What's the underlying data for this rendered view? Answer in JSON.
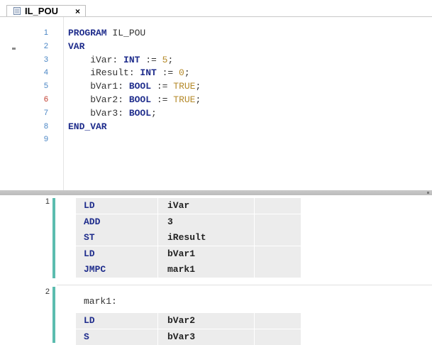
{
  "tab": {
    "title": "IL_POU",
    "close": "×"
  },
  "declaration": {
    "lines": [
      {
        "num": "1",
        "parts": [
          {
            "t": "PROGRAM",
            "c": "kw"
          },
          {
            "t": " IL_POU",
            "c": ""
          }
        ]
      },
      {
        "num": "2",
        "parts": [
          {
            "t": "VAR",
            "c": "kw"
          }
        ]
      },
      {
        "num": "3",
        "parts": [
          {
            "t": "    iVar: ",
            "c": ""
          },
          {
            "t": "INT",
            "c": "kw"
          },
          {
            "t": " := ",
            "c": ""
          },
          {
            "t": "5",
            "c": "val"
          },
          {
            "t": ";",
            "c": ""
          }
        ]
      },
      {
        "num": "4",
        "parts": [
          {
            "t": "    iResult: ",
            "c": ""
          },
          {
            "t": "INT",
            "c": "kw"
          },
          {
            "t": " := ",
            "c": ""
          },
          {
            "t": "0",
            "c": "val"
          },
          {
            "t": ";",
            "c": ""
          }
        ]
      },
      {
        "num": "5",
        "parts": [
          {
            "t": "    bVar1: ",
            "c": ""
          },
          {
            "t": "BOOL",
            "c": "kw"
          },
          {
            "t": " := ",
            "c": ""
          },
          {
            "t": "TRUE",
            "c": "val"
          },
          {
            "t": ";",
            "c": ""
          }
        ]
      },
      {
        "num": "6",
        "parts": [
          {
            "t": "    bVar2: ",
            "c": ""
          },
          {
            "t": "BOOL",
            "c": "kw"
          },
          {
            "t": " := ",
            "c": ""
          },
          {
            "t": "TRUE",
            "c": "val"
          },
          {
            "t": ";",
            "c": ""
          }
        ]
      },
      {
        "num": "7",
        "parts": [
          {
            "t": "    bVar3: ",
            "c": ""
          },
          {
            "t": "BOOL",
            "c": "kw"
          },
          {
            "t": ";",
            "c": ""
          }
        ]
      },
      {
        "num": "8",
        "parts": [
          {
            "t": "END_VAR",
            "c": "kw"
          }
        ]
      },
      {
        "num": "9",
        "parts": []
      }
    ]
  },
  "networks": [
    {
      "num": "1",
      "label": "",
      "rows": [
        {
          "op": "LD",
          "arg": "iVar"
        },
        {
          "op": "ADD",
          "arg": "3"
        },
        {
          "op": "ST",
          "arg": "iResult"
        },
        {
          "op": "LD",
          "arg": "bVar1"
        },
        {
          "op": "JMPC",
          "arg": "mark1"
        }
      ]
    },
    {
      "num": "2",
      "label": "mark1:",
      "rows": [
        {
          "op": "LD",
          "arg": "bVar2"
        },
        {
          "op": "S",
          "arg": "bVar3"
        }
      ]
    }
  ]
}
